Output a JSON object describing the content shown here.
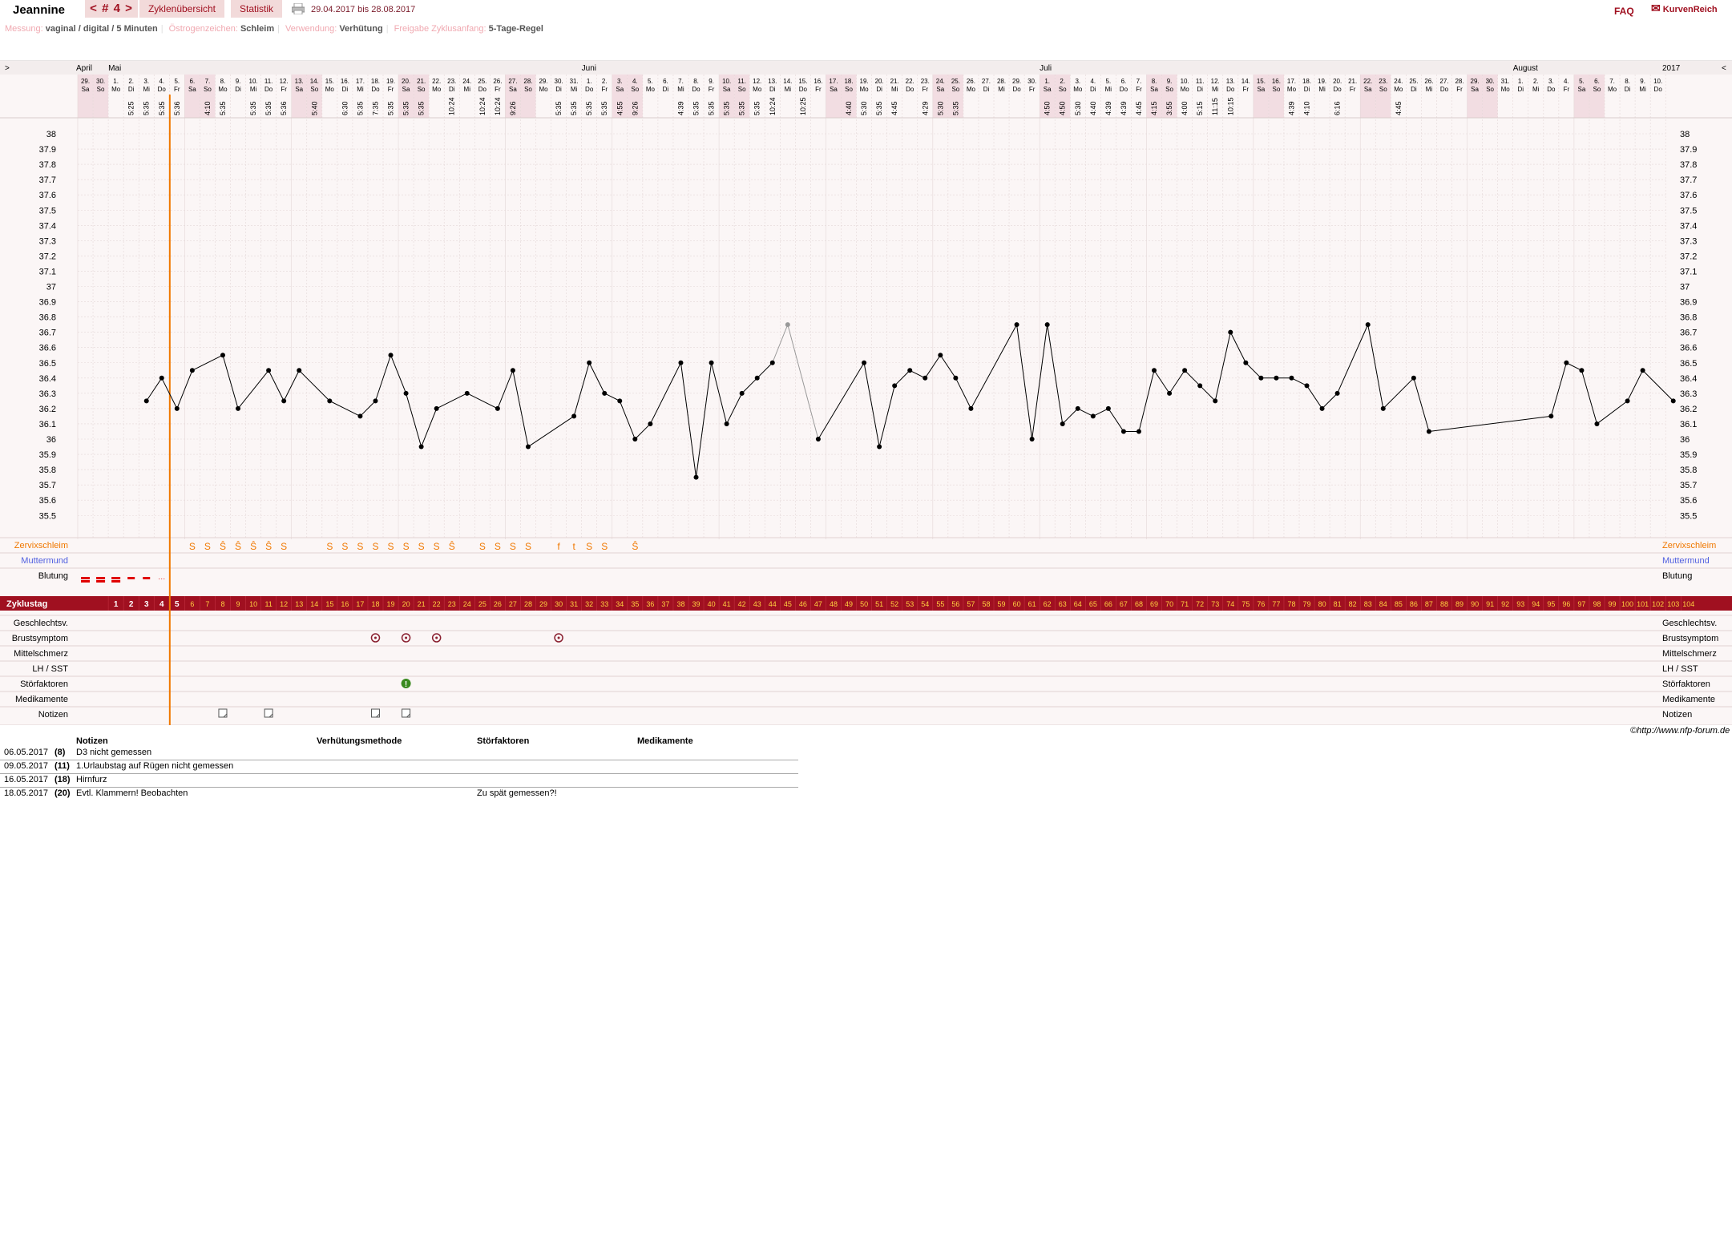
{
  "header": {
    "name": "Jeannine",
    "cycle_nav": "< # 4 >",
    "tab_overview": "Zyklenübersicht",
    "tab_stats": "Statistik",
    "period": "29.04.2017 bis 28.08.2017",
    "faq": "FAQ",
    "logo": "KurvenReich"
  },
  "settings": {
    "messung_label": "Messung:",
    "messung": "vaginal / digital / 5 Minuten",
    "oestrogen_label": "Östrogenzeichen:",
    "oestrogen": "Schleim",
    "verwendung_label": "Verwendung:",
    "verwendung": "Verhütung",
    "freigabe_label": "Freigabe Zyklusanfang:",
    "freigabe": "5-Tage-Regel"
  },
  "chart_data": {
    "type": "line",
    "title": "",
    "year": "2017",
    "months": [
      {
        "label": "April",
        "at": 0
      },
      {
        "label": "Mai",
        "at": 2
      },
      {
        "label": "Juni",
        "at": 33
      },
      {
        "label": "Juli",
        "at": 63
      },
      {
        "label": "August",
        "at": 94
      }
    ],
    "days": [
      "29.",
      "30.",
      "1.",
      "2.",
      "3.",
      "4.",
      "5.",
      "6.",
      "7.",
      "8.",
      "9.",
      "10.",
      "11.",
      "12.",
      "13.",
      "14.",
      "15.",
      "16.",
      "17.",
      "18.",
      "19.",
      "20.",
      "21.",
      "22.",
      "23.",
      "24.",
      "25.",
      "26.",
      "27.",
      "28.",
      "29.",
      "30.",
      "31.",
      "1.",
      "2.",
      "3.",
      "4.",
      "5.",
      "6.",
      "7.",
      "8.",
      "9.",
      "10.",
      "11.",
      "12.",
      "13.",
      "14.",
      "15.",
      "16.",
      "17.",
      "18.",
      "19.",
      "20.",
      "21.",
      "22.",
      "23.",
      "24.",
      "25.",
      "26.",
      "27.",
      "28.",
      "29.",
      "30.",
      "1.",
      "2.",
      "3.",
      "4.",
      "5.",
      "6.",
      "7.",
      "8.",
      "9.",
      "10.",
      "11.",
      "12.",
      "13.",
      "14.",
      "15.",
      "16.",
      "17.",
      "18.",
      "19.",
      "20.",
      "21.",
      "22.",
      "23.",
      "24.",
      "25.",
      "26.",
      "27.",
      "28.",
      "29.",
      "30.",
      "31.",
      "1.",
      "2.",
      "3.",
      "4.",
      "5.",
      "6.",
      "7.",
      "8.",
      "9.",
      "10."
    ],
    "weekday_start": 5,
    "weekdays": [
      "Mo",
      "Di",
      "Mi",
      "Do",
      "Fr",
      "Sa",
      "So"
    ],
    "times": [
      "",
      "",
      "",
      "5:25",
      "5:35",
      "5:35",
      "5:36",
      "",
      "4:10",
      "5:35",
      "",
      "5:35",
      "5:35",
      "5:36",
      "",
      "5:40",
      "",
      "6:30",
      "5:35",
      "7:35",
      "5:35",
      "5:35",
      "5:35",
      "",
      "10:24",
      "",
      "10:24",
      "10:24",
      "9:26",
      "",
      "",
      "5:35",
      "5:35",
      "5:35",
      "5:35",
      "4:55",
      "9:26",
      "",
      "",
      "4:39",
      "5:35",
      "5:35",
      "5:35",
      "5:35",
      "5:35",
      "10:24",
      "",
      "10:25",
      "",
      "",
      "4:40",
      "5:30",
      "5:35",
      "4:45",
      "",
      "4:29",
      "5:30",
      "5:35",
      "",
      "",
      "",
      "",
      "",
      "4:50",
      "4:50",
      "5:30",
      "4:40",
      "4:39",
      "4:39",
      "4:45",
      "4:15",
      "3:55",
      "4:00",
      "5:15",
      "11:15",
      "10:15",
      "",
      "",
      "",
      "4:39",
      "4:10",
      "",
      "6:16",
      "",
      "",
      "",
      "4:45",
      "",
      "",
      "",
      "",
      "",
      "",
      "",
      "",
      "",
      "",
      "",
      "",
      "",
      "",
      ""
    ],
    "xlabel": "",
    "ylabel": "",
    "ylim": [
      35.5,
      38.0
    ],
    "yticks": [
      "38",
      "37.9",
      "37.8",
      "37.7",
      "37.6",
      "37.5",
      "37.4",
      "37.3",
      "37.2",
      "37.1",
      "37",
      "36.9",
      "36.8",
      "36.7",
      "36.6",
      "36.5",
      "36.4",
      "36.3",
      "36.2",
      "36.1",
      "36",
      "35.9",
      "35.8",
      "35.7",
      "35.6",
      "35.5"
    ],
    "series": [
      {
        "points": [
          [
            4,
            36.25
          ],
          [
            5,
            36.4
          ],
          [
            6,
            36.2
          ],
          [
            7,
            36.45
          ],
          [
            9,
            36.55
          ],
          [
            10,
            36.2
          ],
          [
            12,
            36.45
          ],
          [
            13,
            36.25
          ],
          [
            14,
            36.45
          ],
          [
            16,
            36.25
          ],
          [
            18,
            36.15
          ],
          [
            19,
            36.25
          ],
          [
            20,
            36.55
          ],
          [
            21,
            36.3
          ],
          [
            22,
            35.95
          ],
          [
            23,
            36.2
          ],
          [
            25,
            36.3
          ],
          [
            27,
            36.2
          ],
          [
            28,
            36.45
          ],
          [
            29,
            35.95
          ],
          [
            32,
            36.15
          ],
          [
            33,
            36.5
          ],
          [
            34,
            36.3
          ],
          [
            35,
            36.25
          ],
          [
            36,
            36.0
          ],
          [
            37,
            36.1
          ],
          [
            39,
            36.5
          ],
          [
            40,
            35.75
          ],
          [
            41,
            36.5
          ],
          [
            42,
            36.1
          ],
          [
            43,
            36.3
          ],
          [
            44,
            36.4
          ],
          [
            45,
            36.5
          ],
          [
            46,
            36.75
          ],
          [
            48,
            36.0
          ],
          [
            51,
            36.5
          ],
          [
            52,
            35.95
          ],
          [
            53,
            36.35
          ],
          [
            54,
            36.45
          ],
          [
            55,
            36.4
          ],
          [
            56,
            36.55
          ],
          [
            57,
            36.4
          ],
          [
            58,
            36.2
          ],
          [
            61,
            36.75
          ],
          [
            62,
            36.0
          ],
          [
            63,
            36.75
          ],
          [
            64,
            36.1
          ],
          [
            65,
            36.2
          ],
          [
            66,
            36.15
          ],
          [
            67,
            36.2
          ],
          [
            68,
            36.05
          ],
          [
            69,
            36.05
          ],
          [
            70,
            36.45
          ],
          [
            71,
            36.3
          ],
          [
            72,
            36.45
          ],
          [
            73,
            36.35
          ],
          [
            74,
            36.25
          ],
          [
            75,
            36.7
          ],
          [
            76,
            36.5
          ],
          [
            77,
            36.4
          ],
          [
            78,
            36.4
          ],
          [
            79,
            36.4
          ],
          [
            80,
            36.35
          ],
          [
            81,
            36.2
          ],
          [
            82,
            36.3
          ],
          [
            84,
            36.75
          ],
          [
            85,
            36.2
          ],
          [
            87,
            36.4
          ],
          [
            88,
            36.05
          ],
          [
            96,
            36.15
          ],
          [
            97,
            36.5
          ],
          [
            98,
            36.45
          ],
          [
            99,
            36.1
          ],
          [
            101,
            36.25
          ],
          [
            102,
            36.45
          ],
          [
            104,
            36.25
          ]
        ],
        "excluded": [
          [
            46,
            36.75
          ]
        ]
      }
    ],
    "cycle_day_count": 104,
    "cycle_line_day": 5
  },
  "rows": {
    "zervix": "Zervixschleim",
    "muttermund": "Muttermund",
    "blutung": "Blutung",
    "zyklustag": "Zyklustag",
    "geschlecht": "Geschlechtsv.",
    "brust": "Brustsymptom",
    "mittel": "Mittelschmerz",
    "lh": "LH / SST",
    "stoer": "Störfaktoren",
    "medi": "Medikamente",
    "notizen": "Notizen"
  },
  "cervix": [
    [
      7,
      "S"
    ],
    [
      8,
      "S"
    ],
    [
      9,
      "Ŝ"
    ],
    [
      10,
      "Ŝ"
    ],
    [
      11,
      "Ŝ"
    ],
    [
      12,
      "Ŝ"
    ],
    [
      13,
      "S"
    ],
    [
      16,
      "S"
    ],
    [
      17,
      "S"
    ],
    [
      18,
      "S"
    ],
    [
      19,
      "S"
    ],
    [
      20,
      "S"
    ],
    [
      21,
      "S"
    ],
    [
      22,
      "S"
    ],
    [
      23,
      "S"
    ],
    [
      24,
      "Ŝ"
    ],
    [
      26,
      "S"
    ],
    [
      27,
      "S"
    ],
    [
      28,
      "S"
    ],
    [
      29,
      "S"
    ],
    [
      31,
      "f"
    ],
    [
      32,
      "t"
    ],
    [
      33,
      "S"
    ],
    [
      34,
      "S"
    ],
    [
      36,
      "Ŝ"
    ]
  ],
  "breast_days": [
    18,
    20,
    22,
    30
  ],
  "disturb_days": [
    20
  ],
  "note_days": [
    8,
    11,
    18,
    20
  ],
  "copyright": "©http://www.nfp-forum.de",
  "notes_table": {
    "headers": [
      "Notizen",
      "Verhütungsmethode",
      "Störfaktoren",
      "Medikamente"
    ],
    "rows": [
      {
        "date": "06.05.2017",
        "day": "(8)",
        "note": "D3 nicht gemessen",
        "stoer": ""
      },
      {
        "date": "09.05.2017",
        "day": "(11)",
        "note": "1.Urlaubstag auf Rügen nicht gemessen",
        "stoer": ""
      },
      {
        "date": "16.05.2017",
        "day": "(18)",
        "note": "Hirnfurz",
        "stoer": ""
      },
      {
        "date": "18.05.2017",
        "day": "(20)",
        "note": "Evtl. Klammern! Beobachten",
        "stoer": "Zu spät gemessen?!"
      }
    ]
  },
  "colors": {
    "accent": "#a01020",
    "orange": "#f07800",
    "blue": "#5060e0",
    "weekend": "#f2dde2"
  }
}
